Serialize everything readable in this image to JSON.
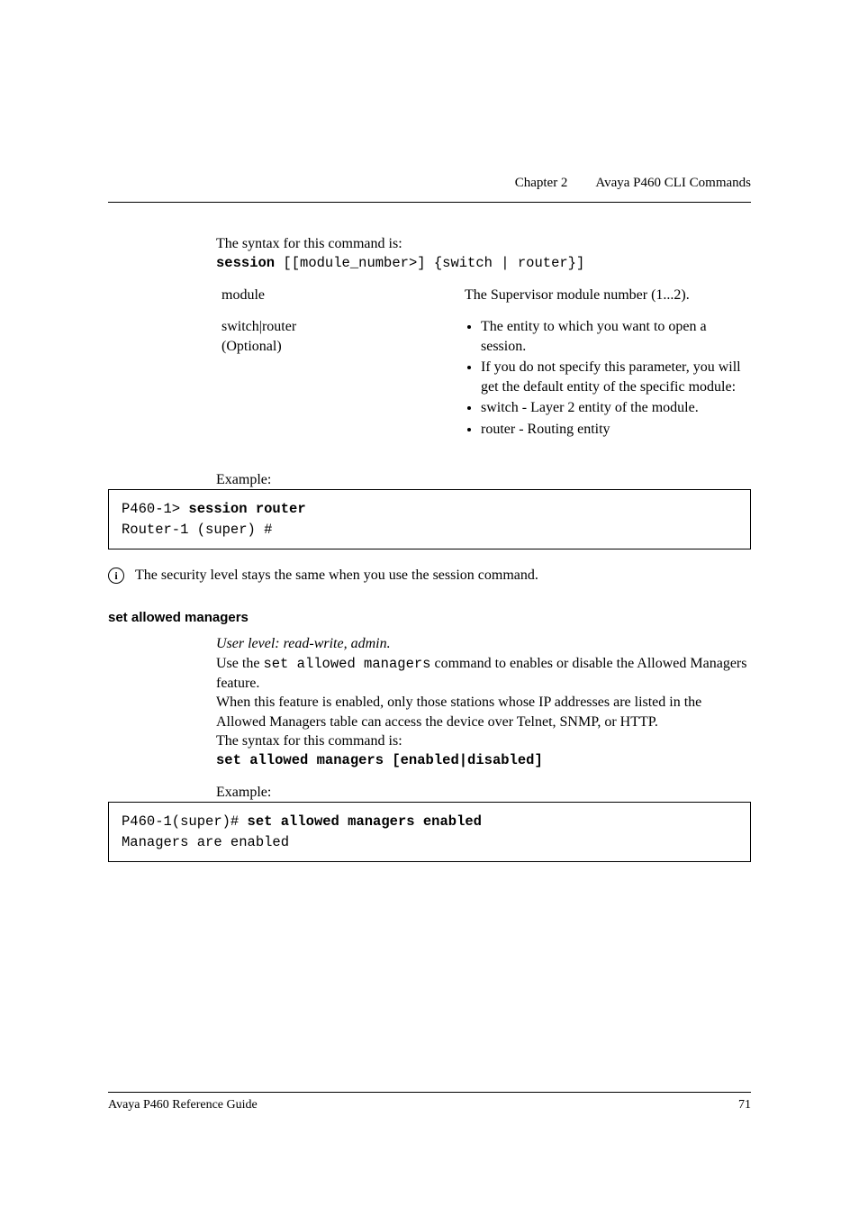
{
  "header": {
    "chapter": "Chapter 2",
    "title": "Avaya P460 CLI Commands"
  },
  "syntax_intro": "The syntax for this command is:",
  "syntax_line": {
    "cmd": "session",
    "args": " [[module_number>] {switch | router}]"
  },
  "params": {
    "module": {
      "name": "module",
      "desc": "The Supervisor module number (1...2)."
    },
    "switch_router": {
      "name": "switch|router",
      "optional": "(Optional)",
      "bullets": [
        "The entity to which you want to open a session.",
        "If you do not specify this parameter, you will get the default entity of the specific module:",
        "switch - Layer 2 entity of the module.",
        "router - Routing entity"
      ]
    }
  },
  "example_label": "Example:",
  "example1": {
    "prompt": "P460-1> ",
    "cmd": "session router",
    "line2": "Router-1 (super) #"
  },
  "note": {
    "icon": "i",
    "text": "The security level stays the same when you use the session command."
  },
  "section2": {
    "heading": "set allowed managers",
    "userlevel": "User level: read-write, admin.",
    "desc_pre": "Use the ",
    "desc_cmd": "set allowed managers",
    "desc_post": " command to enables or disable the Allowed Managers feature.",
    "desc2": "When this feature is enabled, only those stations whose IP addresses are listed in the Allowed Managers table can access the device over Telnet, SNMP, or HTTP.",
    "syntax_intro": "The syntax for this command is:",
    "syntax_cmd": "set allowed managers [enabled|disabled]",
    "example_label": "Example:",
    "example": {
      "prompt": "P460-1(super)# ",
      "cmd": "set allowed managers enabled",
      "line2": "Managers are enabled"
    }
  },
  "footer": {
    "left": "Avaya P460 Reference Guide",
    "right": "71"
  }
}
